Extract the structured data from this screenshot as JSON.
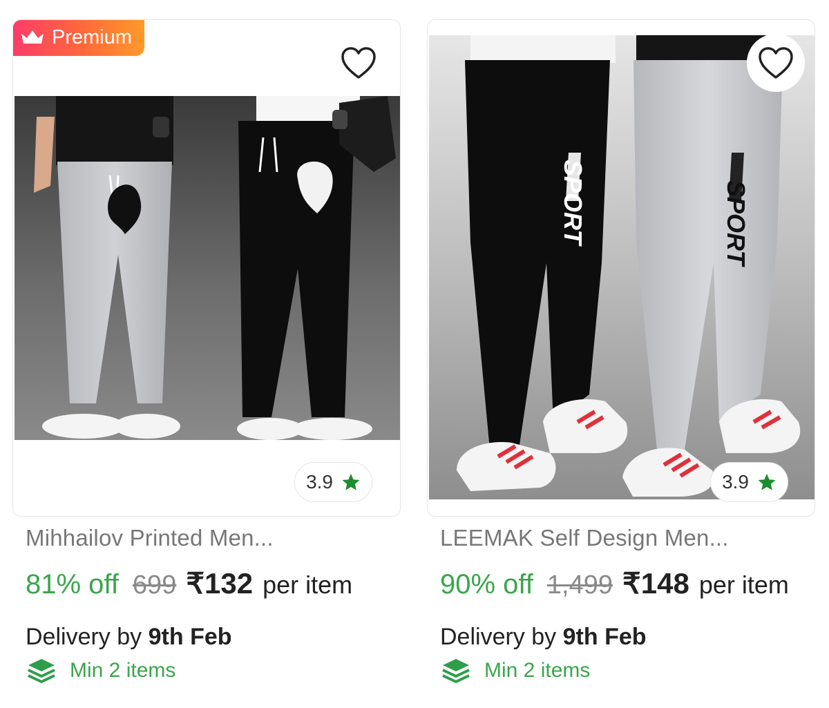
{
  "products": [
    {
      "badge": "Premium",
      "rating": "3.9",
      "title": "Mihhailov Printed Men...",
      "discount": "81% off",
      "mrp": "699",
      "price": "₹132",
      "per_item": "per item",
      "delivery_prefix": "Delivery by",
      "delivery_date": "9th Feb",
      "min_items": "Min 2 items"
    },
    {
      "rating": "3.9",
      "title": "LEEMAK Self Design Men...",
      "discount": "90% off",
      "mrp": "1,499",
      "price": "₹148",
      "per_item": "per item",
      "delivery_prefix": "Delivery by",
      "delivery_date": "9th Feb",
      "min_items": "Min 2 items"
    }
  ],
  "icons": {
    "badge": "crown-icon",
    "wishlist": "heart-icon",
    "rating": "star-icon",
    "min_items": "stack-icon"
  },
  "colors": {
    "discount_green": "#3aa64a",
    "star_green": "#1e8c2e",
    "badge_gradient_start": "#ff3a6a",
    "badge_gradient_end": "#ff9a2a"
  },
  "product_images": [
    "two men wearing light grey and black track pants with wolf print",
    "two men wearing black and light grey track pants with SPORT print and red-striped sneakers"
  ]
}
